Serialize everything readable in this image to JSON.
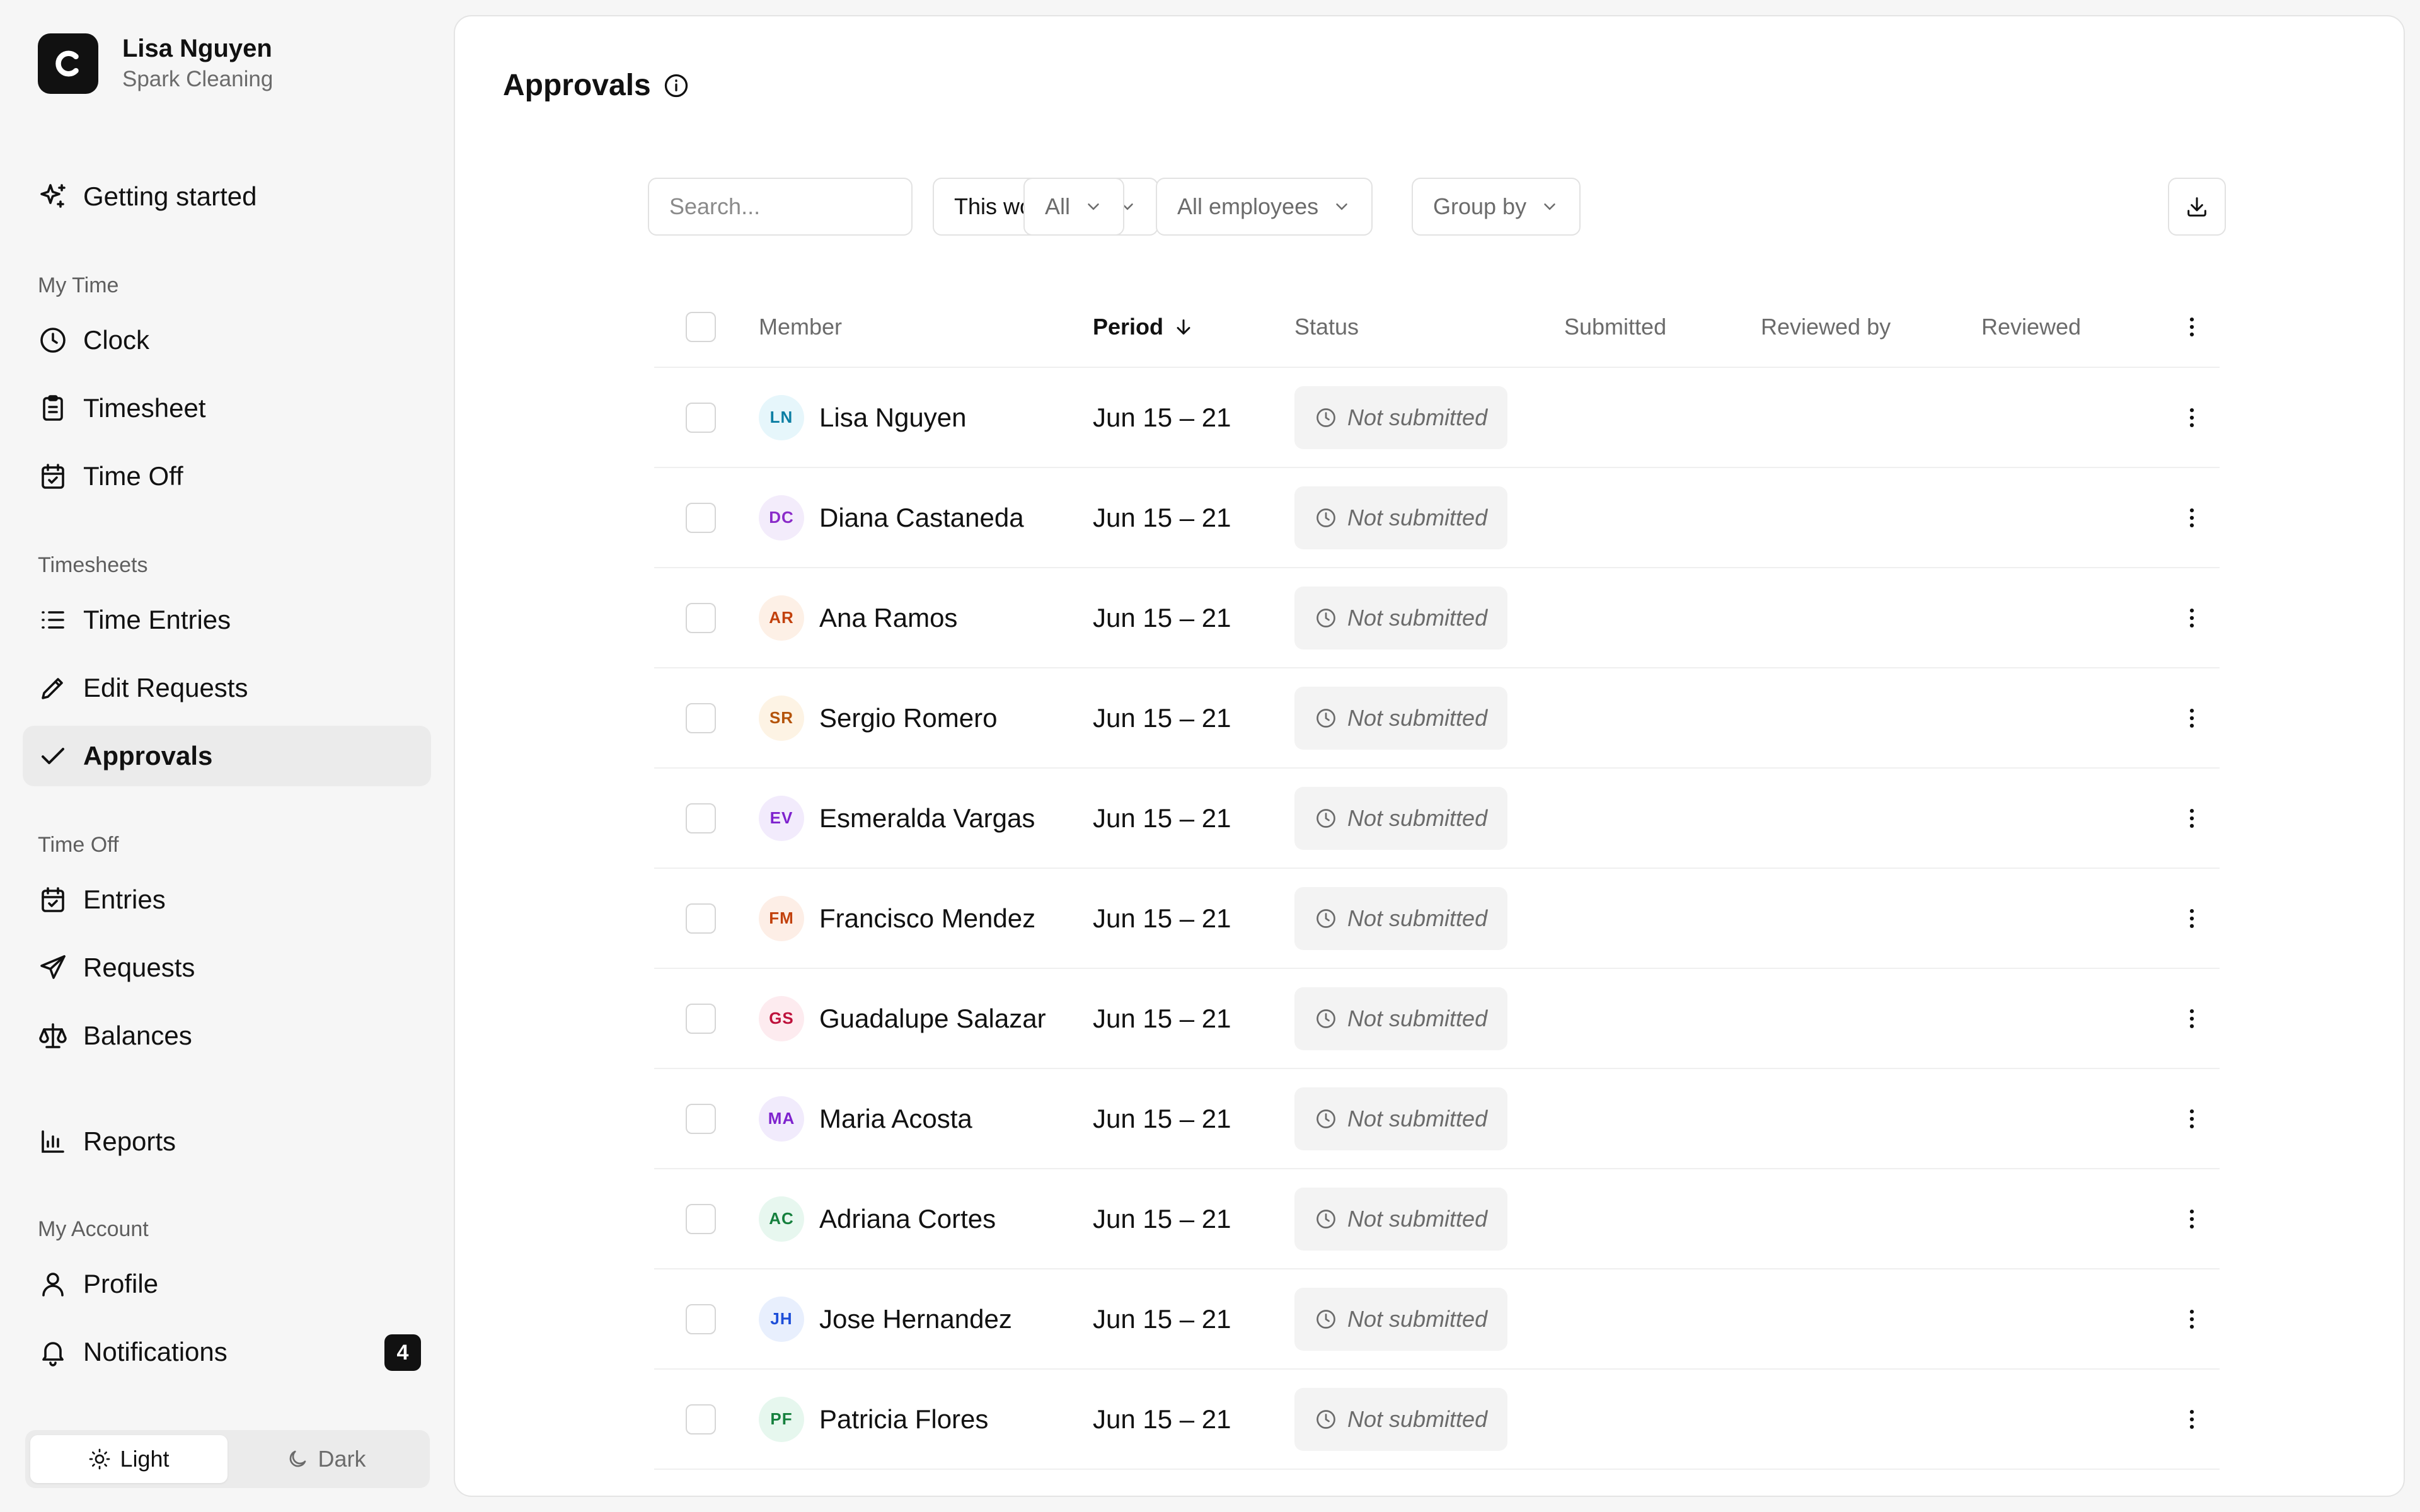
{
  "org": {
    "user_name": "Lisa Nguyen",
    "company": "Spark Cleaning",
    "logo_letter": "C"
  },
  "nav": {
    "getting_started": "Getting started",
    "sections": {
      "my_time": "My Time",
      "timesheets": "Timesheets",
      "time_off": "Time Off",
      "my_account": "My Account"
    },
    "items": {
      "clock": "Clock",
      "timesheet": "Timesheet",
      "time_off": "Time Off",
      "time_entries": "Time Entries",
      "edit_requests": "Edit Requests",
      "approvals": "Approvals",
      "entries": "Entries",
      "requests": "Requests",
      "balances": "Balances",
      "reports": "Reports",
      "profile": "Profile",
      "notifications": "Notifications"
    },
    "notifications_badge": "4"
  },
  "theme": {
    "light": "Light",
    "dark": "Dark",
    "selected": "Light"
  },
  "page": {
    "title": "Approvals"
  },
  "toolbar": {
    "search_placeholder": "Search...",
    "period_filter": "This workweek",
    "status_filter": "All",
    "employee_filter": "All employees",
    "group_by": "Group by"
  },
  "table": {
    "columns": {
      "member": "Member",
      "period": "Period",
      "status": "Status",
      "submitted": "Submitted",
      "reviewed_by": "Reviewed by",
      "reviewed": "Reviewed"
    },
    "sorted_column": "period",
    "rows": [
      {
        "initials": "LN",
        "name": "Lisa Nguyen",
        "period": "Jun 15 – 21",
        "status": "Not submitted",
        "avatar_bg": "#e6f6fb",
        "avatar_fg": "#0b7ea3"
      },
      {
        "initials": "DC",
        "name": "Diana Castaneda",
        "period": "Jun 15 – 21",
        "status": "Not submitted",
        "avatar_bg": "#f3ecfb",
        "avatar_fg": "#8a2bc9"
      },
      {
        "initials": "AR",
        "name": "Ana Ramos",
        "period": "Jun 15 – 21",
        "status": "Not submitted",
        "avatar_bg": "#fdf0e6",
        "avatar_fg": "#c2410c"
      },
      {
        "initials": "SR",
        "name": "Sergio Romero",
        "period": "Jun 15 – 21",
        "status": "Not submitted",
        "avatar_bg": "#fdf3e4",
        "avatar_fg": "#b45309"
      },
      {
        "initials": "EV",
        "name": "Esmeralda Vargas",
        "period": "Jun 15 – 21",
        "status": "Not submitted",
        "avatar_bg": "#f2ebfc",
        "avatar_fg": "#7e22ce"
      },
      {
        "initials": "FM",
        "name": "Francisco Mendez",
        "period": "Jun 15 – 21",
        "status": "Not submitted",
        "avatar_bg": "#fdeee6",
        "avatar_fg": "#c2410c"
      },
      {
        "initials": "GS",
        "name": "Guadalupe Salazar",
        "period": "Jun 15 – 21",
        "status": "Not submitted",
        "avatar_bg": "#fdebef",
        "avatar_fg": "#be123c"
      },
      {
        "initials": "MA",
        "name": "Maria Acosta",
        "period": "Jun 15 – 21",
        "status": "Not submitted",
        "avatar_bg": "#f1ebfc",
        "avatar_fg": "#7e22ce"
      },
      {
        "initials": "AC",
        "name": "Adriana Cortes",
        "period": "Jun 15 – 21",
        "status": "Not submitted",
        "avatar_bg": "#e7f7ef",
        "avatar_fg": "#15803d"
      },
      {
        "initials": "JH",
        "name": "Jose Hernandez",
        "period": "Jun 15 – 21",
        "status": "Not submitted",
        "avatar_bg": "#e8effd",
        "avatar_fg": "#1d4ed8"
      },
      {
        "initials": "PF",
        "name": "Patricia Flores",
        "period": "Jun 15 – 21",
        "status": "Not submitted",
        "avatar_bg": "#e6f7ee",
        "avatar_fg": "#15803d"
      }
    ]
  }
}
